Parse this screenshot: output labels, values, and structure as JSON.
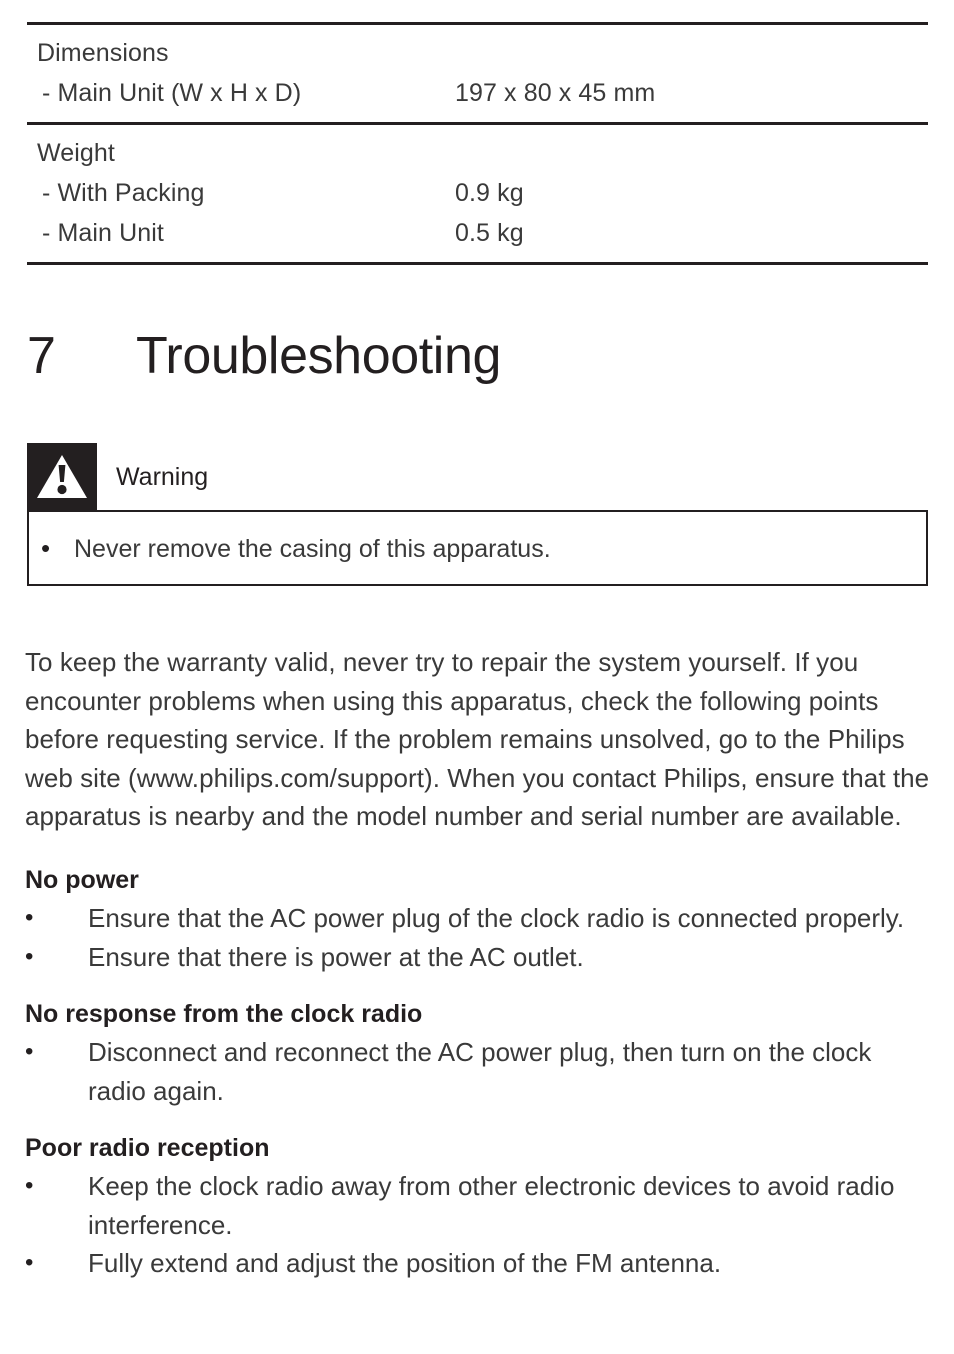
{
  "spec_table": {
    "groups": [
      {
        "name": "dimensions",
        "rows": [
          {
            "label": "Dimensions",
            "value": "",
            "type": "head"
          },
          {
            "label": "- Main Unit (W x H x D)",
            "value": "197 x 80 x 45 mm",
            "type": "sub"
          }
        ]
      },
      {
        "name": "weight",
        "rows": [
          {
            "label": "Weight",
            "value": "",
            "type": "head"
          },
          {
            "label": "- With Packing",
            "value": "0.9 kg",
            "type": "sub"
          },
          {
            "label": "- Main Unit",
            "value": "0.5 kg",
            "type": "sub"
          }
        ]
      }
    ]
  },
  "chapter": {
    "number": "7",
    "title": "Troubleshooting"
  },
  "warning": {
    "icon": "warning-triangle-icon",
    "label": "Warning",
    "bullet_glyph": "•",
    "items": [
      "Never remove the casing of this apparatus."
    ]
  },
  "intro": {
    "paragraph": "To keep the warranty valid, never try to repair the system yourself. If you encounter problems when using this apparatus, check the following points before requesting service. If the problem remains unsolved, go to the Philips web site (www.philips.com/support). When you contact Philips, ensure that the apparatus is nearby and the model number and serial number are available."
  },
  "sections": {
    "bullet_glyph": "•",
    "list": [
      {
        "title": "No power",
        "items": [
          "Ensure that the AC power plug of the clock radio is connected properly.",
          "Ensure that there is power at the AC outlet."
        ]
      },
      {
        "title": "No response from the clock radio",
        "items": [
          "Disconnect and reconnect the AC power plug, then turn on the clock radio again."
        ]
      },
      {
        "title": "Poor radio reception",
        "items": [
          "Keep the clock radio away from other electronic devices to avoid radio interference.",
          "Fully extend and adjust the position of the FM antenna."
        ]
      }
    ]
  },
  "colors": {
    "ink": "#231f20",
    "body_text": "#3a3a3a",
    "page_background": "#ffffff"
  }
}
